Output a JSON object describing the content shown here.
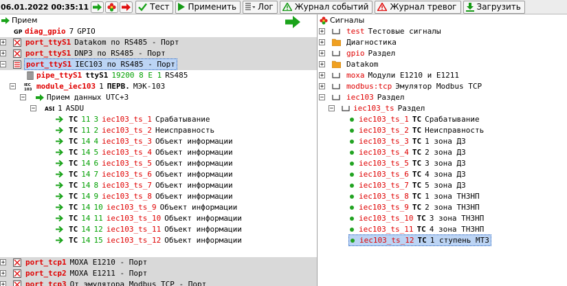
{
  "toolbar": {
    "datetime": "06.01.2022  00:35:11",
    "test": "Тест",
    "apply": "Применить",
    "log": "Лог",
    "event_journal": "Журнал событий",
    "alarm_journal": "Журнал тревог",
    "load": "Загрузить"
  },
  "left": {
    "root": "Прием",
    "diag": {
      "name": "diag_gpio",
      "num": "7",
      "desc": "GPIO"
    },
    "ports_top": [
      {
        "name": "port_ttyS1",
        "desc": "Datakom по RS485 - Порт"
      },
      {
        "name": "port_ttyS1",
        "desc": "DNP3 по RS485 - Порт"
      },
      {
        "name": "port_ttyS1",
        "desc": "IEC103 по RS485 - Порт"
      }
    ],
    "pipe": {
      "name": "pipe_ttyS1",
      "dev": "ttyS1",
      "params": "19200 8 E 1",
      "iface": "RS485"
    },
    "module": {
      "name": "module_iec103",
      "num": "1",
      "mode": "ПЕРВ.",
      "std": "МЭК-103"
    },
    "receive": "Прием данных UTC+3",
    "asdu": {
      "num": "1",
      "label": "ASDU"
    },
    "signals": [
      {
        "tc": "TC",
        "a": "11",
        "b": "3",
        "name": "iec103_ts_1",
        "desc": "Срабатывание"
      },
      {
        "tc": "TC",
        "a": "11",
        "b": "2",
        "name": "iec103_ts_2",
        "desc": "Неисправность"
      },
      {
        "tc": "TC",
        "a": "14",
        "b": "4",
        "name": "iec103_ts_3",
        "desc": "Объект информации"
      },
      {
        "tc": "TC",
        "a": "14",
        "b": "5",
        "name": "iec103_ts_4",
        "desc": "Объект информации"
      },
      {
        "tc": "TC",
        "a": "14",
        "b": "6",
        "name": "iec103_ts_5",
        "desc": "Объект информации"
      },
      {
        "tc": "TC",
        "a": "14",
        "b": "7",
        "name": "iec103_ts_6",
        "desc": "Объект информации"
      },
      {
        "tc": "TC",
        "a": "14",
        "b": "8",
        "name": "iec103_ts_7",
        "desc": "Объект информации"
      },
      {
        "tc": "TC",
        "a": "14",
        "b": "9",
        "name": "iec103_ts_8",
        "desc": "Объект информации"
      },
      {
        "tc": "TC",
        "a": "14",
        "b": "10",
        "name": "iec103_ts_9",
        "desc": "Объект информации"
      },
      {
        "tc": "TC",
        "a": "14",
        "b": "11",
        "name": "iec103_ts_10",
        "desc": "Объект информации"
      },
      {
        "tc": "TC",
        "a": "14",
        "b": "12",
        "name": "iec103_ts_11",
        "desc": "Объект информации"
      },
      {
        "tc": "TC",
        "a": "14",
        "b": "15",
        "name": "iec103_ts_12",
        "desc": "Объект информации"
      }
    ],
    "ports_bottom": [
      {
        "name": "port_tcp1",
        "desc": "MOXA E1210 - Порт"
      },
      {
        "name": "port_tcp2",
        "desc": "MOXA E1211 - Порт"
      },
      {
        "name": "port_tcp3",
        "desc": "От эмулятора Modbus TCP - Порт"
      }
    ]
  },
  "right": {
    "root": "Сигналы",
    "groups": [
      {
        "name": "test",
        "desc": "Тестовые сигналы"
      },
      {
        "name": "",
        "desc": "Диагностика"
      },
      {
        "name": "gpio",
        "desc": "Раздел"
      },
      {
        "name": "",
        "desc": "Datakom"
      },
      {
        "name": "moxa",
        "desc": "Модули E1210 и E1211"
      },
      {
        "name": "modbus:tcp",
        "desc": "Эмулятор Modbus TCP"
      },
      {
        "name": "iec103",
        "desc": "Раздел"
      }
    ],
    "subgroup": {
      "name": "iec103_ts",
      "desc": "Раздел"
    },
    "signals": [
      {
        "name": "iec103_ts_1",
        "tc": "TC",
        "desc": "Срабатывание"
      },
      {
        "name": "iec103_ts_2",
        "tc": "TC",
        "desc": "Неисправность"
      },
      {
        "name": "iec103_ts_3",
        "tc": "TC",
        "desc": "1 зона ДЗ"
      },
      {
        "name": "iec103_ts_4",
        "tc": "TC",
        "desc": "2 зона ДЗ"
      },
      {
        "name": "iec103_ts_5",
        "tc": "TC",
        "desc": "3 зона ДЗ"
      },
      {
        "name": "iec103_ts_6",
        "tc": "TC",
        "desc": "4 зона ДЗ"
      },
      {
        "name": "iec103_ts_7",
        "tc": "TC",
        "desc": "5 зона ДЗ"
      },
      {
        "name": "iec103_ts_8",
        "tc": "TC",
        "desc": "1 зона ТНЗНП"
      },
      {
        "name": "iec103_ts_9",
        "tc": "TC",
        "desc": "2 зона ТНЗНП"
      },
      {
        "name": "iec103_ts_10",
        "tc": "TC",
        "desc": "3 зона ТНЗНП"
      },
      {
        "name": "iec103_ts_11",
        "tc": "TC",
        "desc": "4 зона ТНЗНП"
      },
      {
        "name": "iec103_ts_12",
        "tc": "TC",
        "desc": "1 ступень МТЗ"
      }
    ]
  }
}
